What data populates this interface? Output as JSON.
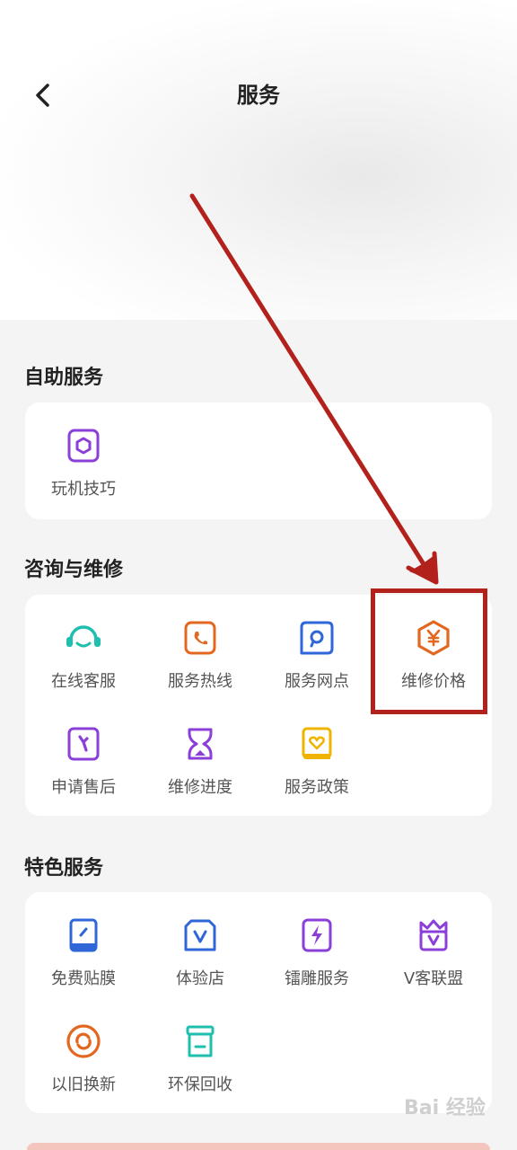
{
  "header": {
    "title": "服务",
    "back_icon": "chevron-left-icon"
  },
  "sections": {
    "self_service": {
      "title": "自助服务",
      "items": [
        {
          "label": "玩机技巧",
          "icon": "tips-icon"
        }
      ]
    },
    "consult_repair": {
      "title": "咨询与维修",
      "items": [
        {
          "label": "在线客服",
          "icon": "headset-icon"
        },
        {
          "label": "服务热线",
          "icon": "phone-icon"
        },
        {
          "label": "服务网点",
          "icon": "location-icon"
        },
        {
          "label": "维修价格",
          "icon": "price-icon"
        },
        {
          "label": "申请售后",
          "icon": "wrench-icon"
        },
        {
          "label": "维修进度",
          "icon": "hourglass-icon"
        },
        {
          "label": "服务政策",
          "icon": "policy-icon"
        }
      ]
    },
    "featured": {
      "title": "特色服务",
      "items": [
        {
          "label": "免费贴膜",
          "icon": "screen-film-icon"
        },
        {
          "label": "体验店",
          "icon": "store-icon"
        },
        {
          "label": "镭雕服务",
          "icon": "laser-engrave-icon"
        },
        {
          "label": "V客联盟",
          "icon": "crown-icon"
        },
        {
          "label": "以旧换新",
          "icon": "trade-in-icon"
        },
        {
          "label": "环保回收",
          "icon": "recycle-bin-icon"
        }
      ]
    }
  },
  "annotation": {
    "color": "#b3211c"
  },
  "watermark": {
    "text": "Bai 经验"
  },
  "colors": {
    "purple": "#8b3fd9",
    "orange": "#e4671f",
    "teal": "#1fbfb0",
    "blue": "#2f66d8",
    "yellow": "#f0b400"
  }
}
